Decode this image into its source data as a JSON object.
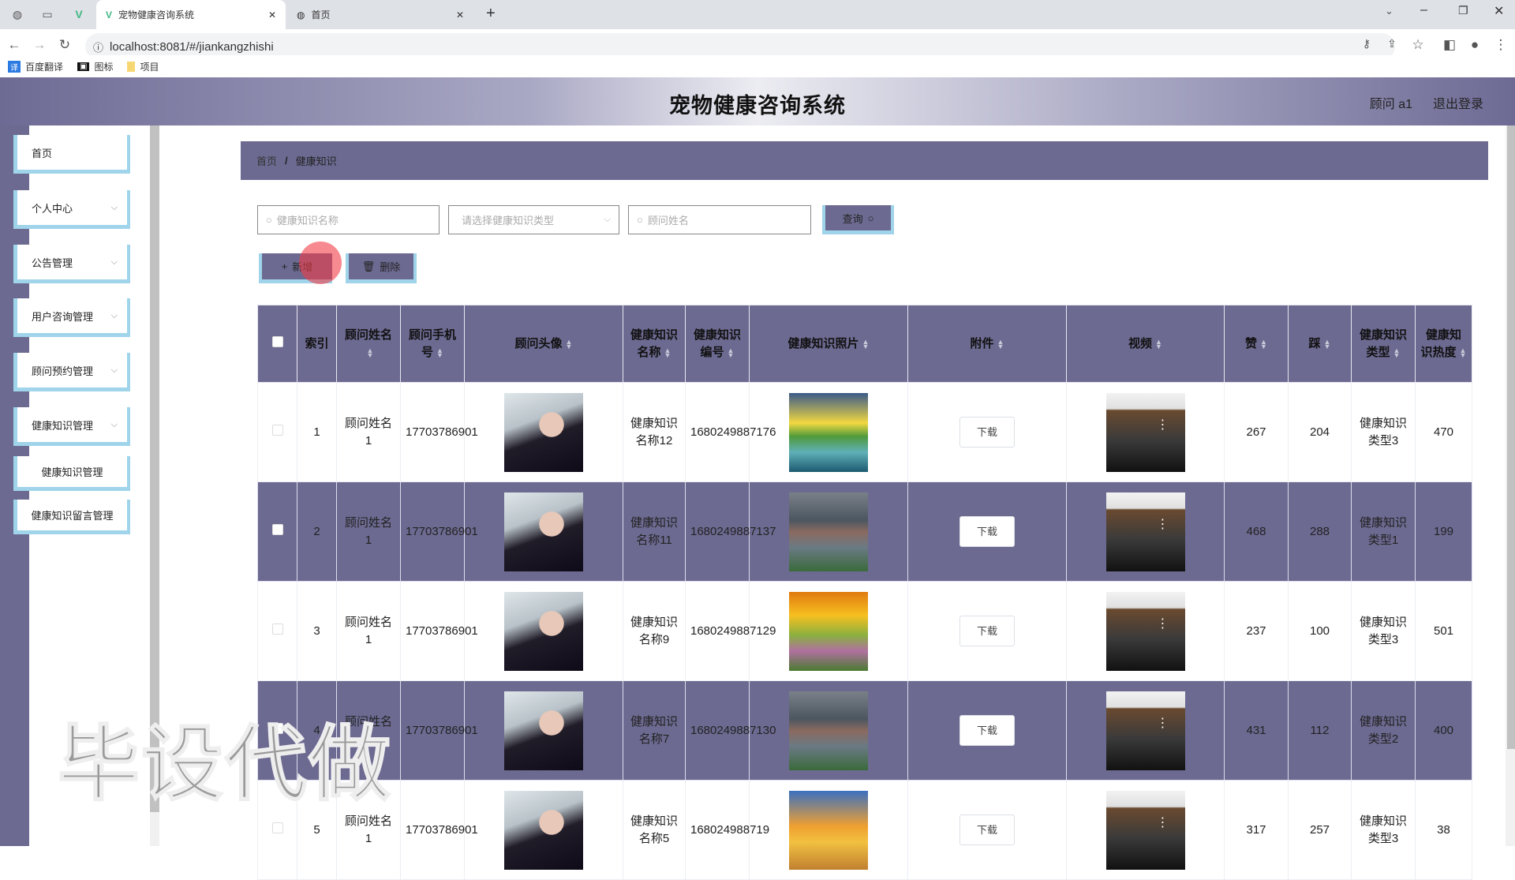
{
  "browser": {
    "tabs": [
      {
        "title": "宠物健康咨询系统",
        "active": true
      },
      {
        "title": "首页",
        "active": false
      }
    ],
    "url": "localhost:8081/#/jiankangzhishi",
    "bookmarks": [
      "百度翻译",
      "图标",
      "项目"
    ]
  },
  "header": {
    "title": "宠物健康咨询系统",
    "user": "顾问 a1",
    "logout": "退出登录"
  },
  "sidebar": {
    "items": [
      {
        "label": "首页",
        "has_chevron": false
      },
      {
        "label": "个人中心",
        "has_chevron": true
      },
      {
        "label": "公告管理",
        "has_chevron": true
      },
      {
        "label": "用户咨询管理",
        "has_chevron": true
      },
      {
        "label": "顾问预约管理",
        "has_chevron": true
      },
      {
        "label": "健康知识管理",
        "has_chevron": true
      }
    ],
    "subitems": [
      "健康知识管理",
      "健康知识留言管理"
    ]
  },
  "breadcrumb": {
    "home": "首页",
    "sep": "/",
    "current": "健康知识"
  },
  "search": {
    "name_placeholder": "健康知识名称",
    "type_placeholder": "请选择健康知识类型",
    "consultant_placeholder": "顾问姓名",
    "query_label": "查询"
  },
  "actions": {
    "add_label": "新增",
    "delete_label": "删除"
  },
  "table": {
    "columns": [
      "索引",
      "顾问姓名",
      "顾问手机号",
      "顾问头像",
      "健康知识名称",
      "健康知识编号",
      "健康知识照片",
      "附件",
      "视频",
      "赞",
      "踩",
      "健康知识类型",
      "健康知识热度"
    ],
    "download_label": "下载",
    "rows": [
      {
        "index": "1",
        "name": "顾问姓名1",
        "phone": "17703786901",
        "title": "健康知识名称12",
        "code": "1680249887176",
        "photo": "p1",
        "likes": "267",
        "dislikes": "204",
        "type": "健康知识类型3",
        "heat": "470"
      },
      {
        "index": "2",
        "name": "顾问姓名1",
        "phone": "17703786901",
        "title": "健康知识名称11",
        "code": "1680249887137",
        "photo": "p2",
        "likes": "468",
        "dislikes": "288",
        "type": "健康知识类型1",
        "heat": "199"
      },
      {
        "index": "3",
        "name": "顾问姓名1",
        "phone": "17703786901",
        "title": "健康知识名称9",
        "code": "1680249887129",
        "photo": "p3",
        "likes": "237",
        "dislikes": "100",
        "type": "健康知识类型3",
        "heat": "501"
      },
      {
        "index": "4",
        "name": "顾问姓名1",
        "phone": "17703786901",
        "title": "健康知识名称7",
        "code": "1680249887130",
        "photo": "p2",
        "likes": "431",
        "dislikes": "112",
        "type": "健康知识类型2",
        "heat": "400"
      },
      {
        "index": "5",
        "name": "顾问姓名1",
        "phone": "17703786901",
        "title": "健康知识名称5",
        "code": "168024988719",
        "photo": "p4",
        "likes": "317",
        "dislikes": "257",
        "type": "健康知识类型3",
        "heat": "38"
      }
    ]
  },
  "watermark": "毕设代做",
  "colors": {
    "primary": "#6c6a91",
    "accent_border": "#9fd4ea"
  }
}
